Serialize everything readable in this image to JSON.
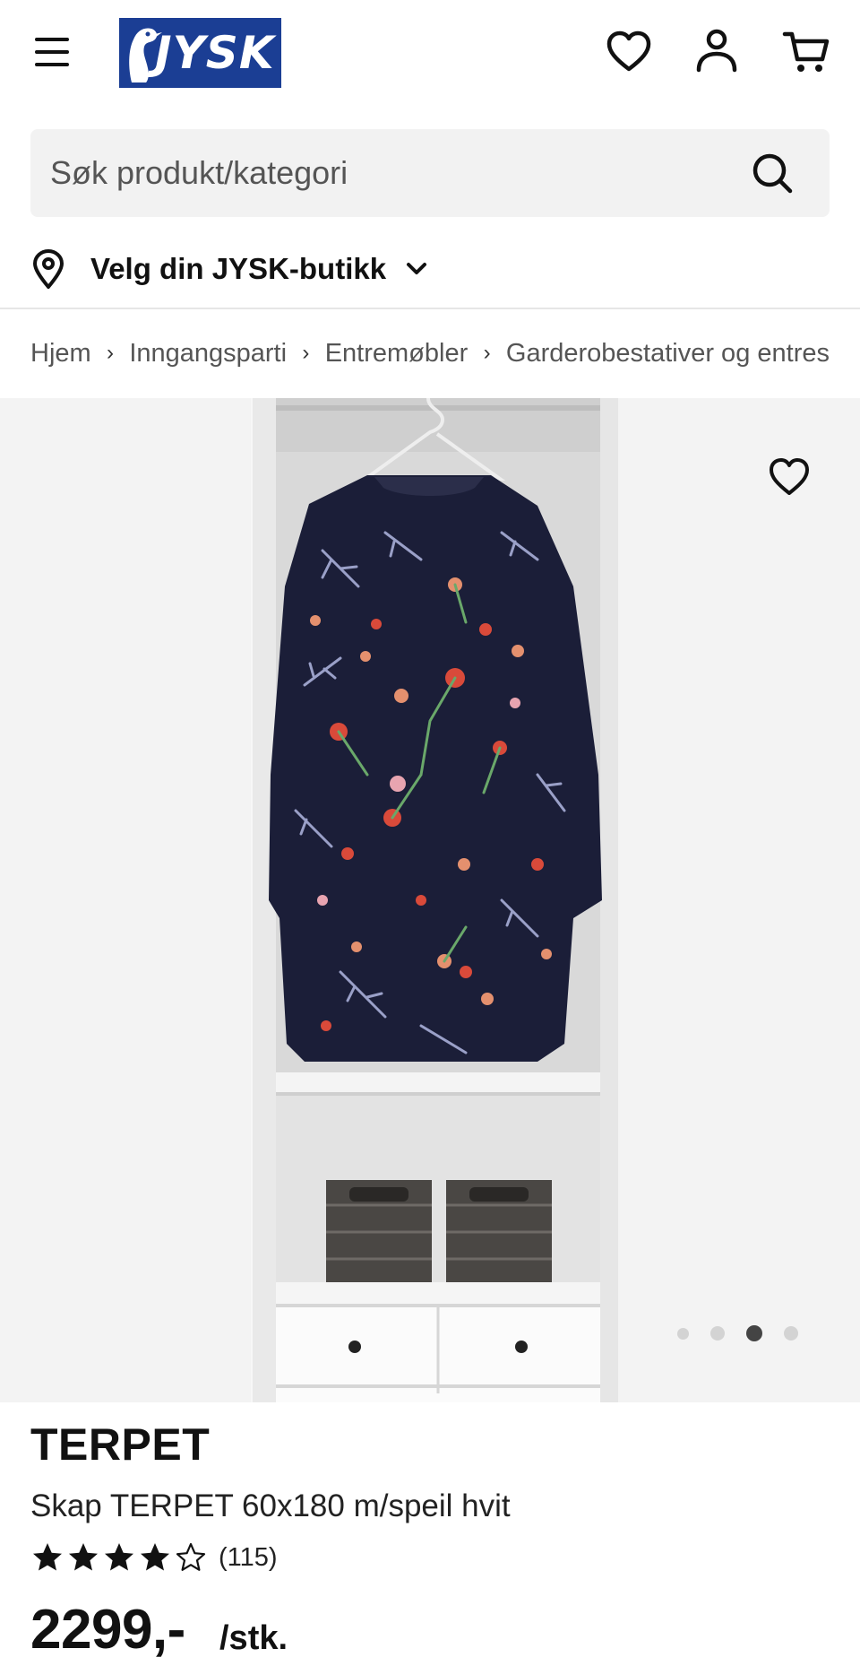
{
  "header": {
    "logo_text": "JYSK",
    "icons": [
      "menu-icon",
      "heart-icon",
      "user-icon",
      "cart-icon"
    ],
    "brand_color": "#1b3e94"
  },
  "search": {
    "placeholder": "Søk produkt/kategori",
    "icon": "search-icon"
  },
  "store": {
    "label": "Velg din JYSK-butikk",
    "icon": "location-pin-icon"
  },
  "breadcrumb": {
    "items": [
      "Hjem",
      "Inngangsparti",
      "Entremøbler",
      "Garderobestativer og entres"
    ],
    "separator": "›"
  },
  "gallery": {
    "dots_total": 4,
    "active_index": 2
  },
  "product": {
    "brand": "TERPET",
    "name": "Skap TERPET 60x180 m/speil hvit",
    "rating": 4,
    "rating_max": 5,
    "review_count": "(115)",
    "price": "2299,-",
    "unit": "/stk."
  }
}
